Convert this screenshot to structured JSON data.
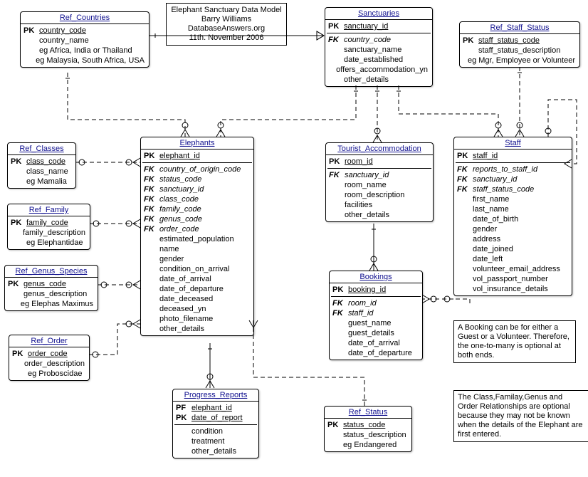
{
  "meta": {
    "title": "Elephant Sanctuary Data Model",
    "author": "Barry Williams",
    "site": "DatabaseAnswers.org",
    "date": "11th. November 2006"
  },
  "entities": {
    "ref_countries": {
      "title": "Ref_Countries",
      "fields": [
        {
          "key": "PK",
          "name": "country_code",
          "underline": true
        },
        {
          "key": "",
          "name": "country_name"
        },
        {
          "key": "",
          "name": "eg Africa, India or Thailand"
        },
        {
          "key": "",
          "name": "eg Malaysia, South Africa, USA"
        }
      ]
    },
    "sanctuaries": {
      "title": "Sanctuaries",
      "fields": [
        {
          "key": "PK",
          "name": "sanctuary_id",
          "underline": true
        },
        {
          "sep": true
        },
        {
          "key": "FK",
          "name": "country_code",
          "fk": true
        },
        {
          "key": "",
          "name": "sanctuary_name"
        },
        {
          "key": "",
          "name": "date_established"
        },
        {
          "key": "",
          "name": "offers_accommodation_yn"
        },
        {
          "key": "",
          "name": "other_details"
        }
      ]
    },
    "ref_staff_status": {
      "title": "Ref_Staff_Status",
      "fields": [
        {
          "key": "PK",
          "name": "staff_status_code",
          "underline": true
        },
        {
          "key": "",
          "name": "staff_status_description"
        },
        {
          "key": "",
          "name": "eg Mgr, Employee or Volunteer"
        }
      ]
    },
    "ref_classes": {
      "title": "Ref_Classes",
      "fields": [
        {
          "key": "PK",
          "name": "class_code",
          "underline": true
        },
        {
          "key": "",
          "name": "class_name"
        },
        {
          "key": "",
          "name": "eg Mamalia"
        }
      ]
    },
    "ref_family": {
      "title": "Ref_Family",
      "fields": [
        {
          "key": "PK",
          "name": "family_code",
          "underline": true
        },
        {
          "key": "",
          "name": "family_description"
        },
        {
          "key": "",
          "name": "eg Elephantidae"
        }
      ]
    },
    "ref_genus_species": {
      "title": "Ref_Genus_Species",
      "fields": [
        {
          "key": "PK",
          "name": "genus_code",
          "underline": true
        },
        {
          "key": "",
          "name": "genus_description"
        },
        {
          "key": "",
          "name": "eg Elephas Maximus"
        }
      ]
    },
    "ref_order": {
      "title": "Ref_Order",
      "fields": [
        {
          "key": "PK",
          "name": "order_code",
          "underline": true
        },
        {
          "key": "",
          "name": "order_description"
        },
        {
          "key": "",
          "name": "eg Proboscidae"
        }
      ]
    },
    "elephants": {
      "title": "Elephants",
      "fields": [
        {
          "key": "PK",
          "name": "elephant_id",
          "underline": true
        },
        {
          "sep": true
        },
        {
          "key": "FK",
          "name": "country_of_origin_code",
          "fk": true
        },
        {
          "key": "FK",
          "name": "status_code",
          "fk": true
        },
        {
          "key": "FK",
          "name": "sanctuary_id",
          "fk": true
        },
        {
          "key": "FK",
          "name": "class_code",
          "fk": true
        },
        {
          "key": "FK",
          "name": "family_code",
          "fk": true
        },
        {
          "key": "FK",
          "name": "genus_code",
          "fk": true
        },
        {
          "key": "FK",
          "name": "order_code",
          "fk": true
        },
        {
          "key": "",
          "name": "estimated_population"
        },
        {
          "key": "",
          "name": "name"
        },
        {
          "key": "",
          "name": "gender"
        },
        {
          "key": "",
          "name": "condition_on_arrival"
        },
        {
          "key": "",
          "name": "date_of_arrival"
        },
        {
          "key": "",
          "name": "date_of_departure"
        },
        {
          "key": "",
          "name": "date_deceased"
        },
        {
          "key": "",
          "name": "deceased_yn"
        },
        {
          "key": "",
          "name": "photo_filename"
        },
        {
          "key": "",
          "name": "other_details"
        }
      ]
    },
    "tourist_accommodation": {
      "title": "Tourist_Accommodation",
      "fields": [
        {
          "key": "PK",
          "name": "room_id",
          "underline": true
        },
        {
          "sep": true
        },
        {
          "key": "FK",
          "name": "sanctuary_id",
          "fk": true
        },
        {
          "key": "",
          "name": "room_name"
        },
        {
          "key": "",
          "name": "room_description"
        },
        {
          "key": "",
          "name": "facilities"
        },
        {
          "key": "",
          "name": "other_details"
        }
      ]
    },
    "staff": {
      "title": "Staff",
      "fields": [
        {
          "key": "PK",
          "name": "staff_id",
          "underline": true
        },
        {
          "sep": true
        },
        {
          "key": "FK",
          "name": "reports_to_staff_id",
          "fk": true
        },
        {
          "key": "FK",
          "name": "sanctuary_id",
          "fk": true
        },
        {
          "key": "FK",
          "name": "staff_status_code",
          "fk": true
        },
        {
          "key": "",
          "name": "first_name"
        },
        {
          "key": "",
          "name": "last_name"
        },
        {
          "key": "",
          "name": "date_of_birth"
        },
        {
          "key": "",
          "name": "gender"
        },
        {
          "key": "",
          "name": "address"
        },
        {
          "key": "",
          "name": "date_joined"
        },
        {
          "key": "",
          "name": "date_left"
        },
        {
          "key": "",
          "name": "volunteer_email_address"
        },
        {
          "key": "",
          "name": "vol_passport_number"
        },
        {
          "key": "",
          "name": "vol_insurance_details"
        }
      ]
    },
    "bookings": {
      "title": "Bookings",
      "fields": [
        {
          "key": "PK",
          "name": "booking_id",
          "underline": true
        },
        {
          "sep": true
        },
        {
          "key": "FK",
          "name": "room_id",
          "fk": true
        },
        {
          "key": "FK",
          "name": "staff_id",
          "fk": true
        },
        {
          "key": "",
          "name": "guest_name"
        },
        {
          "key": "",
          "name": "guest_details"
        },
        {
          "key": "",
          "name": "date_of_arrival"
        },
        {
          "key": "",
          "name": "date_of_departure"
        }
      ]
    },
    "progress_reports": {
      "title": "Progress_Reports",
      "fields": [
        {
          "key": "PF",
          "name": "elephant_id",
          "underline": true
        },
        {
          "key": "PK",
          "name": "date_of_report",
          "underline": true
        },
        {
          "sep": true
        },
        {
          "key": "",
          "name": "condition"
        },
        {
          "key": "",
          "name": "treatment"
        },
        {
          "key": "",
          "name": "other_details"
        }
      ]
    },
    "ref_status": {
      "title": "Ref_Status",
      "fields": [
        {
          "key": "PK",
          "name": "status_code",
          "underline": true
        },
        {
          "key": "",
          "name": "status_description"
        },
        {
          "key": "",
          "name": "eg Endangered"
        }
      ]
    }
  },
  "notes": {
    "booking_note": "A Booking can be for either a Guest or a Volunteer. Therefore, the one-to-many is optional at both ends.",
    "optional_note": "The Class,Familay,Genus and Order Relationships are optional because they may not be known when the details of the Elephant are first entered."
  }
}
